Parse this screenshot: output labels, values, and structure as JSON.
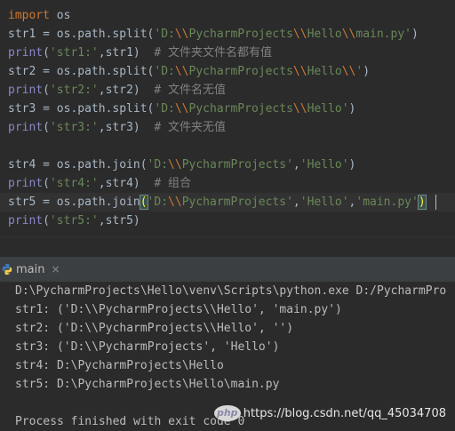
{
  "editor": {
    "lines": [
      {
        "segments": [
          {
            "t": "import",
            "c": "kw"
          },
          {
            "t": " os",
            "c": ""
          }
        ]
      },
      {
        "segments": [
          {
            "t": "str1 = os.path.split(",
            "c": ""
          },
          {
            "t": "'D:",
            "c": "str"
          },
          {
            "t": "\\\\",
            "c": "esc"
          },
          {
            "t": "PycharmProjects",
            "c": "str"
          },
          {
            "t": "\\\\",
            "c": "esc"
          },
          {
            "t": "Hello",
            "c": "str"
          },
          {
            "t": "\\\\",
            "c": "esc"
          },
          {
            "t": "main.py'",
            "c": "str"
          },
          {
            "t": ")",
            "c": ""
          }
        ]
      },
      {
        "segments": [
          {
            "t": "print",
            "c": "builtin"
          },
          {
            "t": "(",
            "c": ""
          },
          {
            "t": "'str1:'",
            "c": "str"
          },
          {
            "t": ",str1)  ",
            "c": ""
          },
          {
            "t": "# 文件夹文件名都有值",
            "c": "comment"
          }
        ]
      },
      {
        "segments": [
          {
            "t": "str2 = os.path.split(",
            "c": ""
          },
          {
            "t": "'D:",
            "c": "str"
          },
          {
            "t": "\\\\",
            "c": "esc"
          },
          {
            "t": "PycharmProjects",
            "c": "str"
          },
          {
            "t": "\\\\",
            "c": "esc"
          },
          {
            "t": "Hello",
            "c": "str"
          },
          {
            "t": "\\\\",
            "c": "esc"
          },
          {
            "t": "'",
            "c": "str"
          },
          {
            "t": ")",
            "c": ""
          }
        ]
      },
      {
        "segments": [
          {
            "t": "print",
            "c": "builtin"
          },
          {
            "t": "(",
            "c": ""
          },
          {
            "t": "'str2:'",
            "c": "str"
          },
          {
            "t": ",str2)  ",
            "c": ""
          },
          {
            "t": "# 文件名无值",
            "c": "comment"
          }
        ]
      },
      {
        "segments": [
          {
            "t": "str3 = os.path.split(",
            "c": ""
          },
          {
            "t": "'D:",
            "c": "str"
          },
          {
            "t": "\\\\",
            "c": "esc"
          },
          {
            "t": "PycharmProjects",
            "c": "str"
          },
          {
            "t": "\\\\",
            "c": "esc"
          },
          {
            "t": "Hello'",
            "c": "str"
          },
          {
            "t": ")",
            "c": ""
          }
        ]
      },
      {
        "segments": [
          {
            "t": "print",
            "c": "builtin"
          },
          {
            "t": "(",
            "c": ""
          },
          {
            "t": "'str3:'",
            "c": "str"
          },
          {
            "t": ",str3)  ",
            "c": ""
          },
          {
            "t": "# 文件夹无值",
            "c": "comment"
          }
        ]
      },
      {
        "segments": []
      },
      {
        "segments": [
          {
            "t": "str4 = os.path.join(",
            "c": ""
          },
          {
            "t": "'D:",
            "c": "str"
          },
          {
            "t": "\\\\",
            "c": "esc"
          },
          {
            "t": "PycharmProjects'",
            "c": "str"
          },
          {
            "t": ",",
            "c": ""
          },
          {
            "t": "'Hello'",
            "c": "str"
          },
          {
            "t": ")",
            "c": ""
          }
        ]
      },
      {
        "segments": [
          {
            "t": "print",
            "c": "builtin"
          },
          {
            "t": "(",
            "c": ""
          },
          {
            "t": "'str4:'",
            "c": "str"
          },
          {
            "t": ",str4)  ",
            "c": ""
          },
          {
            "t": "# 组合",
            "c": "comment"
          }
        ]
      },
      {
        "segments": [
          {
            "t": "str5 = os.path.join",
            "c": ""
          },
          {
            "t": "(",
            "c": "paren-hl-yellow"
          },
          {
            "t": "'D:",
            "c": "str"
          },
          {
            "t": "\\\\",
            "c": "esc"
          },
          {
            "t": "PycharmProjects'",
            "c": "str"
          },
          {
            "t": ",",
            "c": ""
          },
          {
            "t": "'Hello'",
            "c": "str"
          },
          {
            "t": ",",
            "c": ""
          },
          {
            "t": "'main.py'",
            "c": "str"
          },
          {
            "t": ")",
            "c": "paren-hl-yellow"
          }
        ]
      },
      {
        "segments": [
          {
            "t": "print",
            "c": "builtin"
          },
          {
            "t": "(",
            "c": ""
          },
          {
            "t": "'str5:'",
            "c": "str"
          },
          {
            "t": ",str5)",
            "c": ""
          }
        ]
      }
    ]
  },
  "run_panel": {
    "tab_label": "main",
    "close_glyph": "×",
    "icon": "python-icon",
    "console_lines": [
      "D:\\PycharmProjects\\Hello\\venv\\Scripts\\python.exe D:/PycharmPro",
      "str1: ('D:\\\\PycharmProjects\\\\Hello', 'main.py')",
      "str2: ('D:\\\\PycharmProjects\\\\Hello', '')",
      "str3: ('D:\\\\PycharmProjects', 'Hello')",
      "str4: D:\\PycharmProjects\\Hello",
      "str5: D:\\PycharmProjects\\Hello\\main.py",
      "",
      "Process finished with exit code 0"
    ]
  },
  "watermark": {
    "url": "https://blog.csdn.net/qq_45034708",
    "logo_text": "php"
  },
  "colors": {
    "background": "#2b2b2b",
    "keyword": "#cc7832",
    "string": "#6a8759",
    "builtin": "#8888c6",
    "comment": "#808080"
  }
}
